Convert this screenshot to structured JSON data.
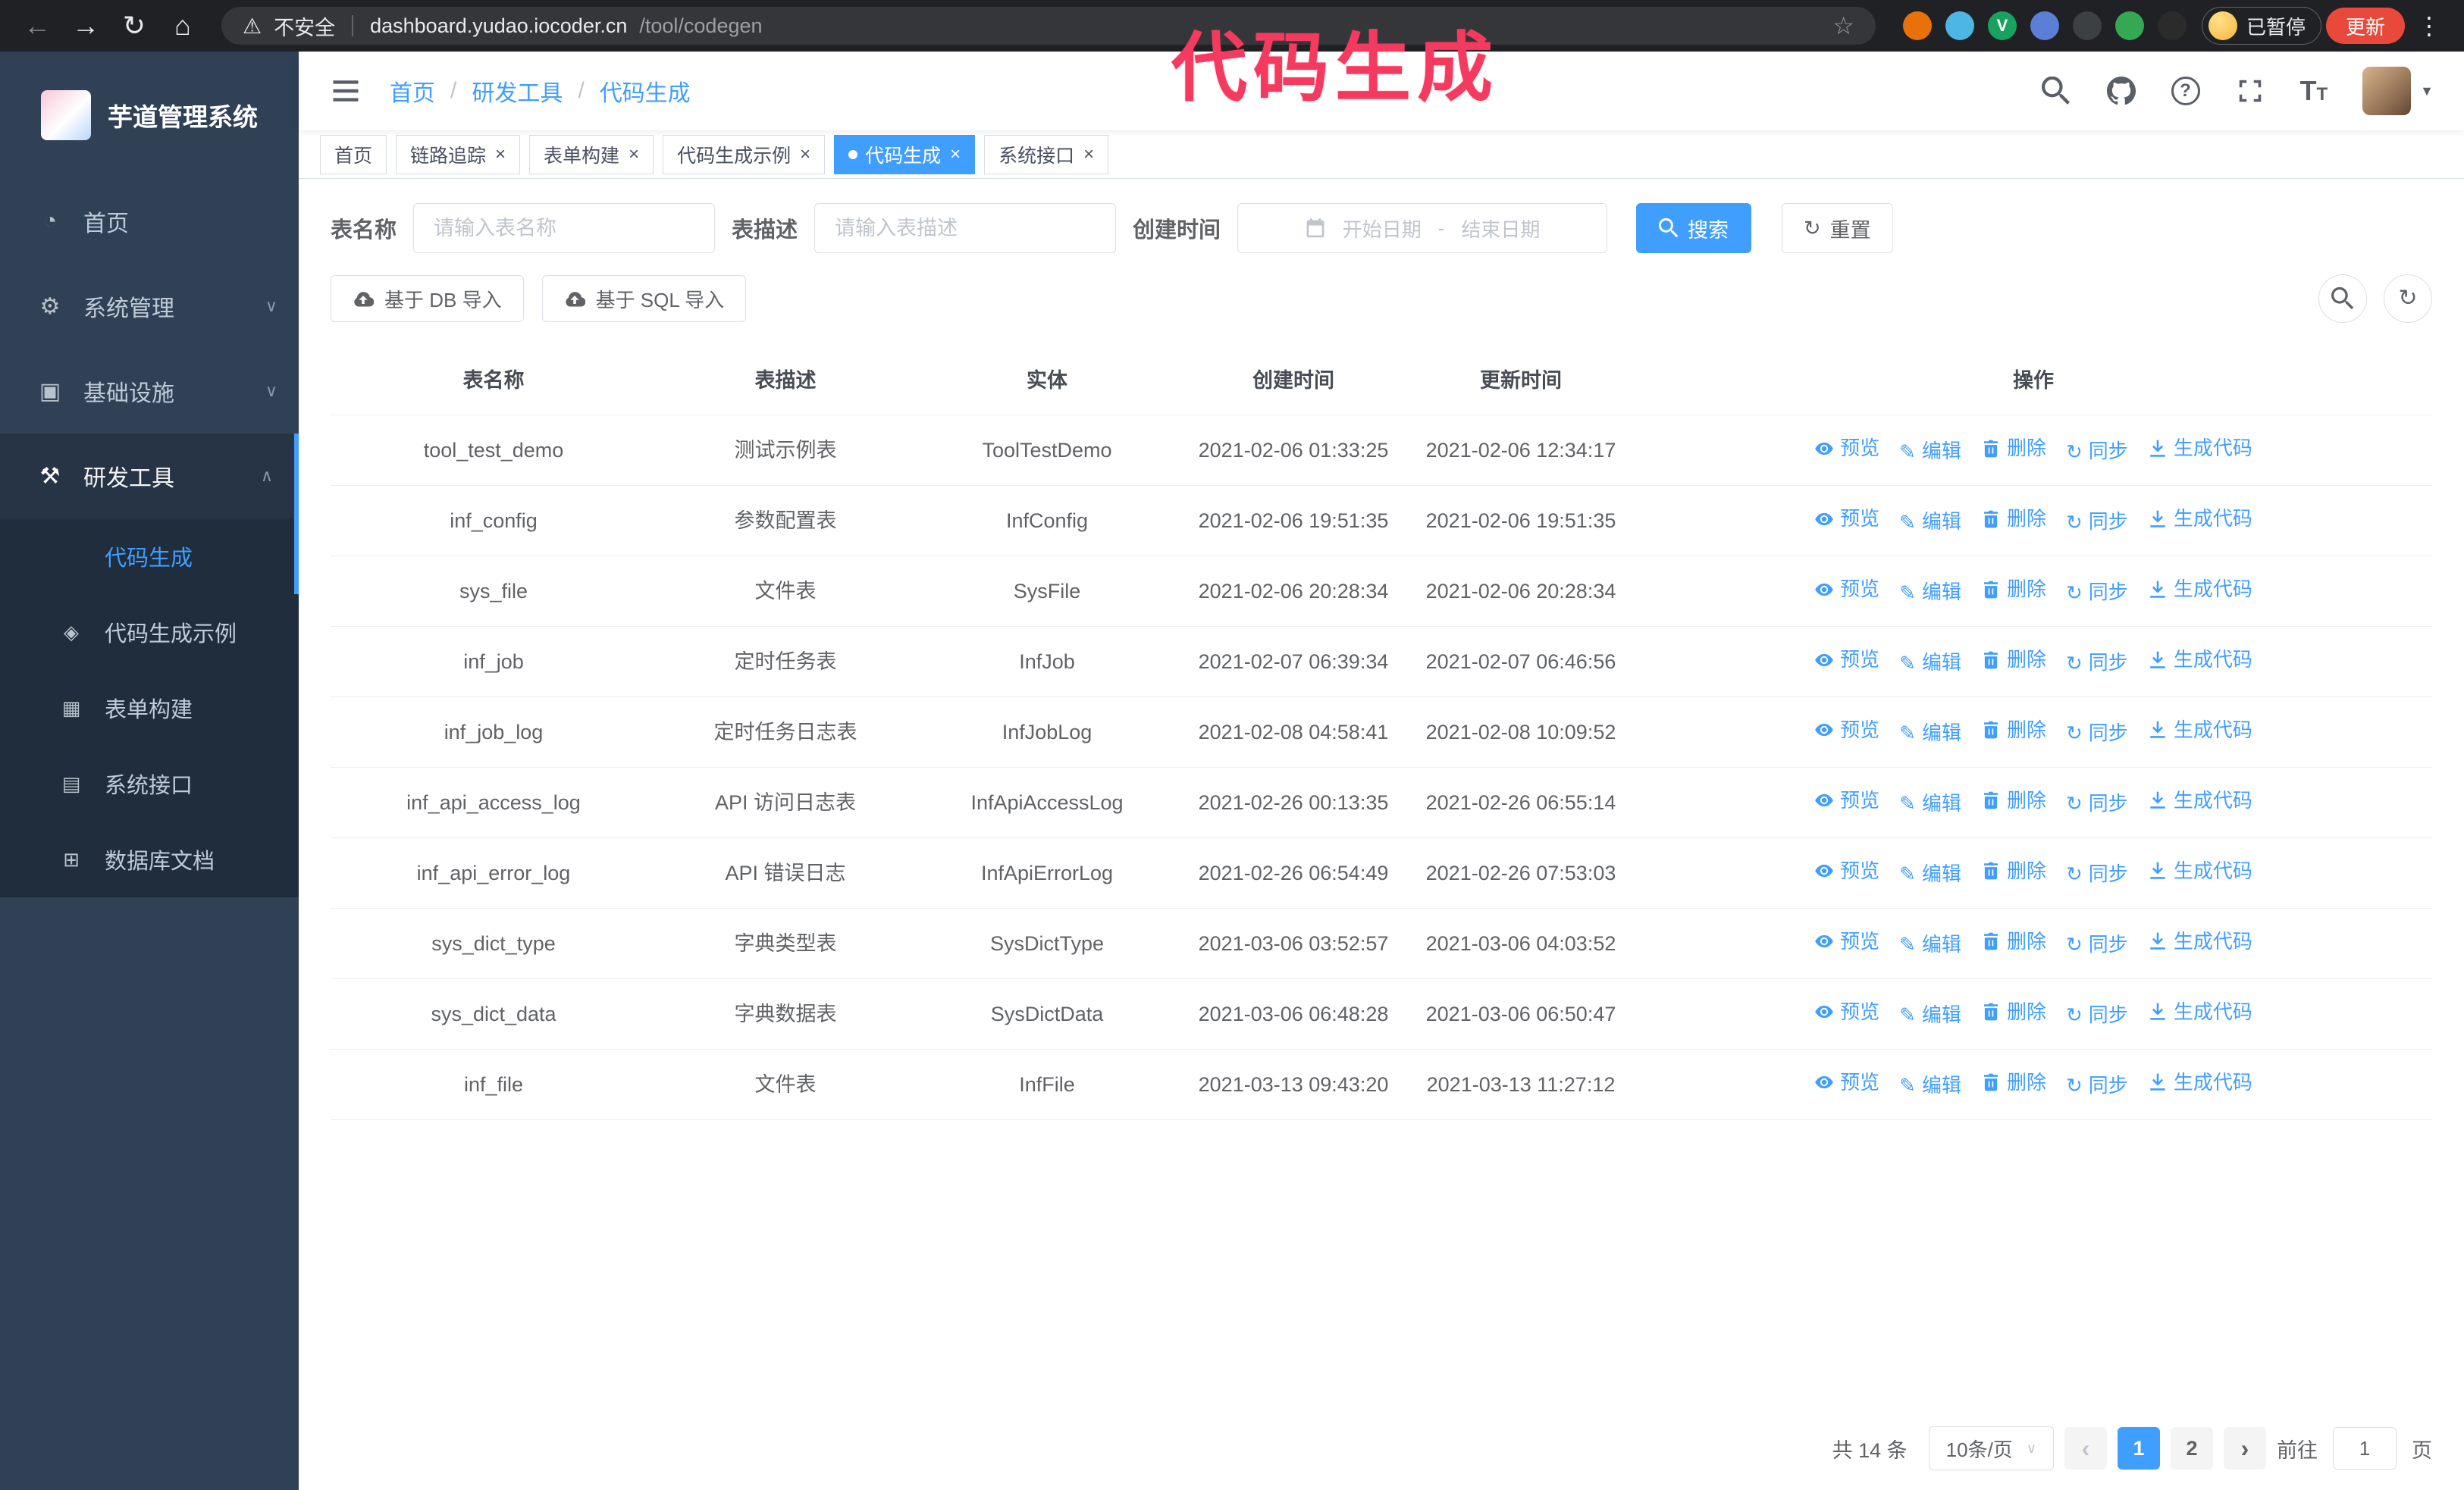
{
  "colors": {
    "accent": "#409EFF",
    "annotation": "#F43B5F",
    "sidebar_bg": "#304156",
    "submenu_bg": "#1F2D3D",
    "update_button": "#E9493B",
    "chrome_bg": "#202124"
  },
  "annotation": {
    "text": "代码生成"
  },
  "browser": {
    "insecure_label": "不安全",
    "url_host": "dashboard.yudao.iocoder.cn",
    "url_path": "/tool/codegen",
    "paused_badge": "已暂停",
    "update_button": "更新",
    "extensions": [
      {
        "name": "extension-orange",
        "color": "#e8710a"
      },
      {
        "name": "extension-blue-drop",
        "color": "#4db6e2"
      },
      {
        "name": "extension-green-v",
        "color": "#19a15f",
        "letter": "V"
      },
      {
        "name": "extension-people",
        "color": "#5b7fd4"
      },
      {
        "name": "extension-dark",
        "color": "#3c4043"
      },
      {
        "name": "extension-leaf",
        "color": "#34a853"
      },
      {
        "name": "extension-paw",
        "color": "#2b2b2b"
      }
    ]
  },
  "sidebar": {
    "title": "芋道管理系统",
    "menu": [
      {
        "icon": "dashboard",
        "label": "首页"
      },
      {
        "icon": "gear",
        "label": "系统管理",
        "chevron": "down"
      },
      {
        "icon": "monitor",
        "label": "基础设施",
        "chevron": "down"
      },
      {
        "icon": "tools",
        "label": "研发工具",
        "chevron": "up",
        "active": true,
        "children": [
          {
            "icon": "code",
            "label": "代码生成",
            "active": true
          },
          {
            "icon": "example",
            "label": "代码生成示例"
          },
          {
            "icon": "form",
            "label": "表单构建"
          },
          {
            "icon": "api",
            "label": "系统接口"
          },
          {
            "icon": "db",
            "label": "数据库文档"
          }
        ]
      }
    ]
  },
  "header": {
    "breadcrumb": [
      "首页",
      "研发工具",
      "代码生成"
    ]
  },
  "tags": [
    {
      "label": "首页",
      "closable": false,
      "active": false
    },
    {
      "label": "链路追踪",
      "closable": true,
      "active": false
    },
    {
      "label": "表单构建",
      "closable": true,
      "active": false
    },
    {
      "label": "代码生成示例",
      "closable": true,
      "active": false
    },
    {
      "label": "代码生成",
      "closable": true,
      "active": true
    },
    {
      "label": "系统接口",
      "closable": true,
      "active": false
    }
  ],
  "filters": {
    "table_name_label": "表名称",
    "table_name_placeholder": "请输入表名称",
    "table_desc_label": "表描述",
    "table_desc_placeholder": "请输入表描述",
    "create_time_label": "创建时间",
    "date_start_placeholder": "开始日期",
    "date_separator": "-",
    "date_end_placeholder": "结束日期",
    "search_button": "搜索",
    "reset_button": "重置"
  },
  "toolbar": {
    "import_db": "基于 DB 导入",
    "import_sql": "基于 SQL 导入"
  },
  "table": {
    "columns": [
      "表名称",
      "表描述",
      "实体",
      "创建时间",
      "更新时间",
      "操作"
    ],
    "actions": [
      "预览",
      "编辑",
      "删除",
      "同步",
      "生成代码"
    ],
    "rows": [
      {
        "name": "tool_test_demo",
        "desc": "测试示例表",
        "entity": "ToolTestDemo",
        "created": "2021-02-06 01:33:25",
        "updated": "2021-02-06 12:34:17"
      },
      {
        "name": "inf_config",
        "desc": "参数配置表",
        "entity": "InfConfig",
        "created": "2021-02-06 19:51:35",
        "updated": "2021-02-06 19:51:35"
      },
      {
        "name": "sys_file",
        "desc": "文件表",
        "entity": "SysFile",
        "created": "2021-02-06 20:28:34",
        "updated": "2021-02-06 20:28:34"
      },
      {
        "name": "inf_job",
        "desc": "定时任务表",
        "entity": "InfJob",
        "created": "2021-02-07 06:39:34",
        "updated": "2021-02-07 06:46:56"
      },
      {
        "name": "inf_job_log",
        "desc": "定时任务日志表",
        "entity": "InfJobLog",
        "created": "2021-02-08 04:58:41",
        "updated": "2021-02-08 10:09:52"
      },
      {
        "name": "inf_api_access_log",
        "desc": "API 访问日志表",
        "entity": "InfApiAccessLog",
        "created": "2021-02-26 00:13:35",
        "updated": "2021-02-26 06:55:14"
      },
      {
        "name": "inf_api_error_log",
        "desc": "API 错误日志",
        "entity": "InfApiErrorLog",
        "created": "2021-02-26 06:54:49",
        "updated": "2021-02-26 07:53:03"
      },
      {
        "name": "sys_dict_type",
        "desc": "字典类型表",
        "entity": "SysDictType",
        "created": "2021-03-06 03:52:57",
        "updated": "2021-03-06 04:03:52"
      },
      {
        "name": "sys_dict_data",
        "desc": "字典数据表",
        "entity": "SysDictData",
        "created": "2021-03-06 06:48:28",
        "updated": "2021-03-06 06:50:47"
      },
      {
        "name": "inf_file",
        "desc": "文件表",
        "entity": "InfFile",
        "created": "2021-03-13 09:43:20",
        "updated": "2021-03-13 11:27:12"
      }
    ]
  },
  "pagination": {
    "total": "共 14 条",
    "page_size": "10条/页",
    "prev": "‹",
    "next": "›",
    "pages": [
      "1",
      "2"
    ],
    "active": "1",
    "goto_label": "前往",
    "goto_value": "1",
    "goto_suffix": "页"
  }
}
